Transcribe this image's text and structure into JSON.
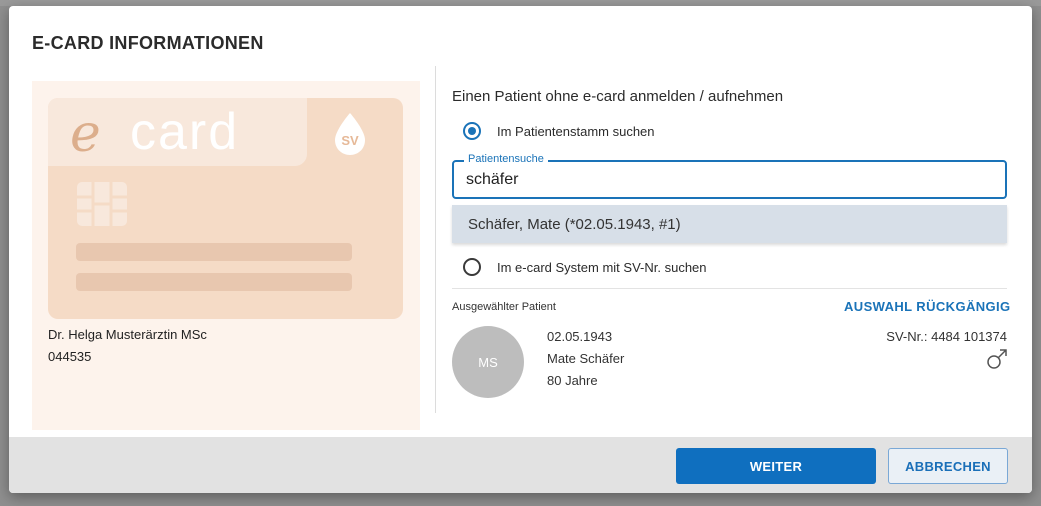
{
  "dialog": {
    "title": "E-CARD INFORMATIONEN"
  },
  "card": {
    "logo_e": "e",
    "logo_rest": "card",
    "sv_logo": "SV",
    "holder_name": "Dr. Helga Musterärztin MSc",
    "holder_number": "044535"
  },
  "form": {
    "section_title": "Einen Patient ohne e-card anmelden / aufnehmen",
    "option_stamm": {
      "label": "Im Patientenstamm suchen",
      "checked": true
    },
    "search": {
      "label": "Patientensuche",
      "value": "schäfer"
    },
    "suggestion": "Schäfer, Mate (*02.05.1943, #1)",
    "option_ecard": {
      "label": "Im e-card System mit SV-Nr. suchen",
      "checked": false
    }
  },
  "selected": {
    "label": "Ausgewählter Patient",
    "undo_label": "AUSWAHL RÜCKGÄNGIG",
    "initials": "MS",
    "birthdate": "02.05.1943",
    "name": "Mate Schäfer",
    "age": "80 Jahre",
    "sv_nr": "SV-Nr.: 4484 101374",
    "gender_icon": "male-icon"
  },
  "footer": {
    "primary_label": "WEITER",
    "secondary_label": "ABBRECHEN"
  },
  "colors": {
    "accent": "#1a73b8",
    "primary_button": "#0f6fbf",
    "card_bg": "#f5dbc6",
    "panel_bg": "#fdf3ec",
    "suggestion_bg": "#d7dfe8"
  }
}
